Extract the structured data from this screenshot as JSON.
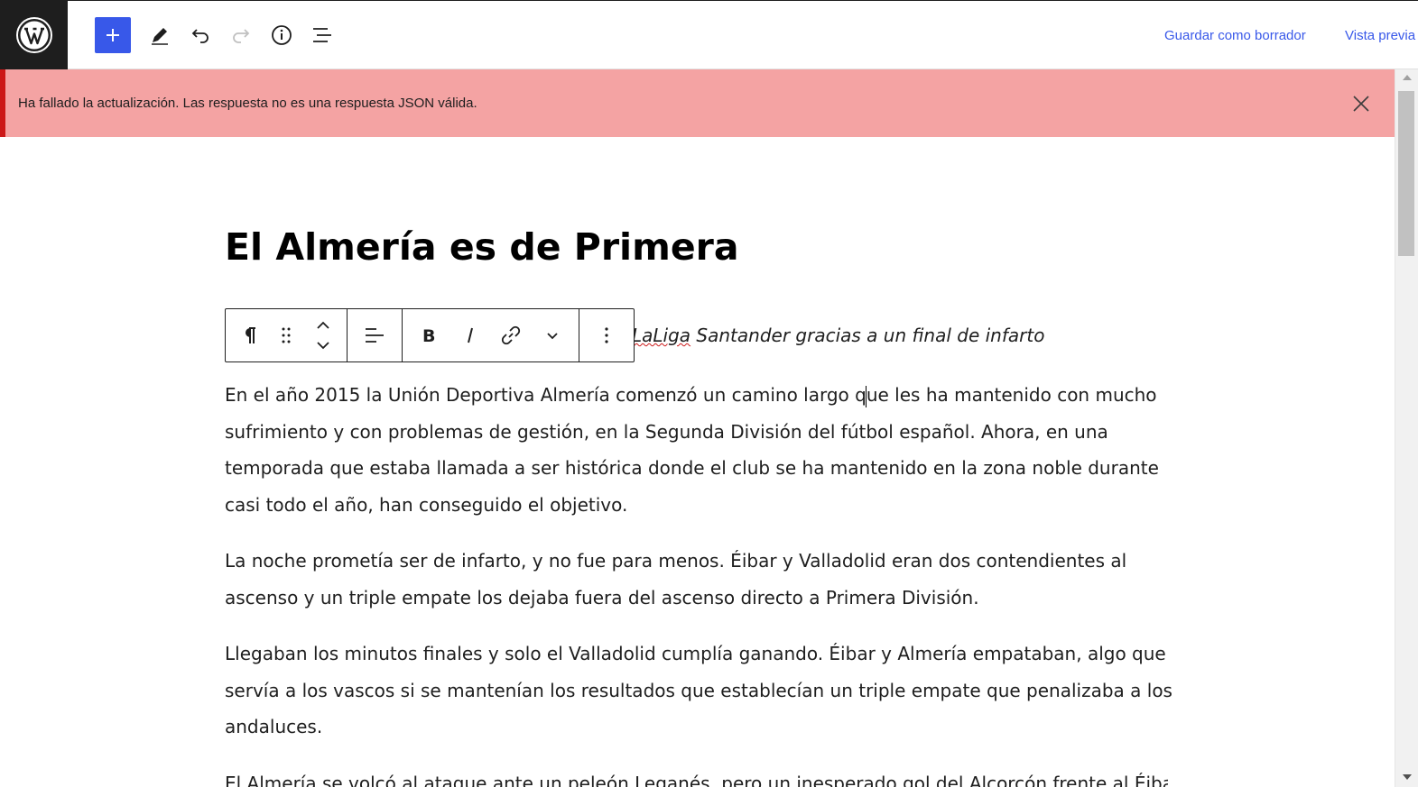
{
  "topbar": {
    "save_draft": "Guardar como borrador",
    "preview": "Vista previa",
    "icons": [
      "wordpress-logo-icon",
      "plus-icon",
      "pencil-icon",
      "undo-icon",
      "redo-icon",
      "info-icon",
      "list-view-icon"
    ]
  },
  "notice": {
    "text": "Ha fallado la actualización. Las respuesta no es una respuesta JSON válida.",
    "background": "#f4a3a3",
    "border": "#cc1818"
  },
  "post": {
    "title": "El Almería es de Primera",
    "subtitle_prefix": "LaLiga",
    "subtitle_rest": " Santander gracias a un final de infarto",
    "p1_before_caret": "En el año 2015 la Unión Deportiva Almería comenzó un camino largo q",
    "p1_after_caret": "ue les ha mantenido con mucho sufrimiento y con problemas de gestión, en la Segunda División del fútbol español. Ahora, en una temporada que estaba llamada a ser histórica donde el club se ha mantenido en la zona noble durante casi todo el año, han conseguido el objetivo.",
    "p2": "La noche prometía ser de infarto, y no fue para menos. Éibar y Valladolid eran dos contendientes al ascenso y un triple empate los dejaba fuera del ascenso directo a Primera División.",
    "p3": "Llegaban los minutos finales y solo el Valladolid cumplía ganando. Éibar y Almería empataban, algo que servía a los vascos si se mantenían los resultados que establecían un triple empate que penalizaba a los andaluces.",
    "p4": "El Almería se volcó al ataque ante un peleón Leganés, pero un inesperado gol del Alcorcón frente al Éibar"
  },
  "block_toolbar": {
    "icons": [
      "paragraph-icon",
      "drag-handle-icon",
      "move-up-icon",
      "move-down-icon",
      "align-left-icon",
      "bold-icon",
      "italic-icon",
      "link-icon",
      "chevron-down-icon",
      "more-options-icon"
    ]
  },
  "colors": {
    "accent": "#3858e9",
    "dark": "#1e1e1e"
  }
}
